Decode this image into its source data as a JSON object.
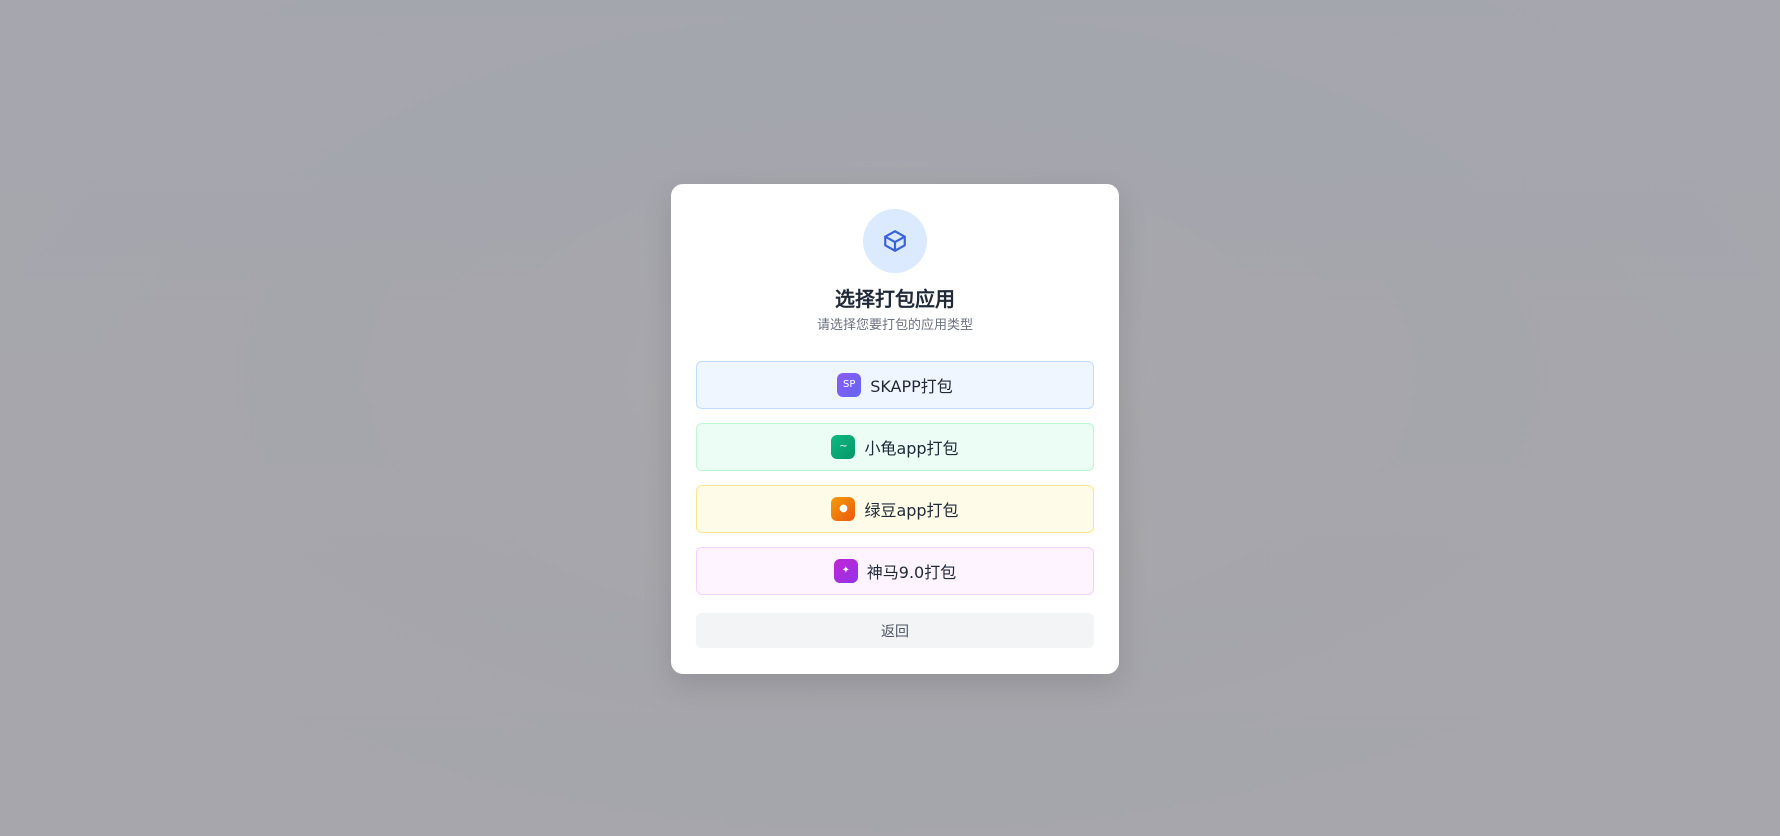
{
  "dialog": {
    "title": "选择打包应用",
    "subtitle": "请选择您要打包的应用类型",
    "header_icon": "package-cube-icon",
    "options": [
      {
        "label": "SKAPP打包",
        "icon": "skapp-app-icon",
        "icon_glyph": "SP",
        "accent": "#8b5cf6"
      },
      {
        "label": "小龟app打包",
        "icon": "turtle-app-icon",
        "icon_glyph": "~",
        "accent": "#10b981"
      },
      {
        "label": "绿豆app打包",
        "icon": "bean-app-icon",
        "icon_glyph": "●",
        "accent": "#f59e0b"
      },
      {
        "label": "神马9.0打包",
        "icon": "shenma-app-icon",
        "icon_glyph": "✦",
        "accent": "#c026d3"
      }
    ],
    "back_label": "返回"
  },
  "colors": {
    "primary": "#3b63d9",
    "header_icon_bg": "#dbeafe"
  }
}
